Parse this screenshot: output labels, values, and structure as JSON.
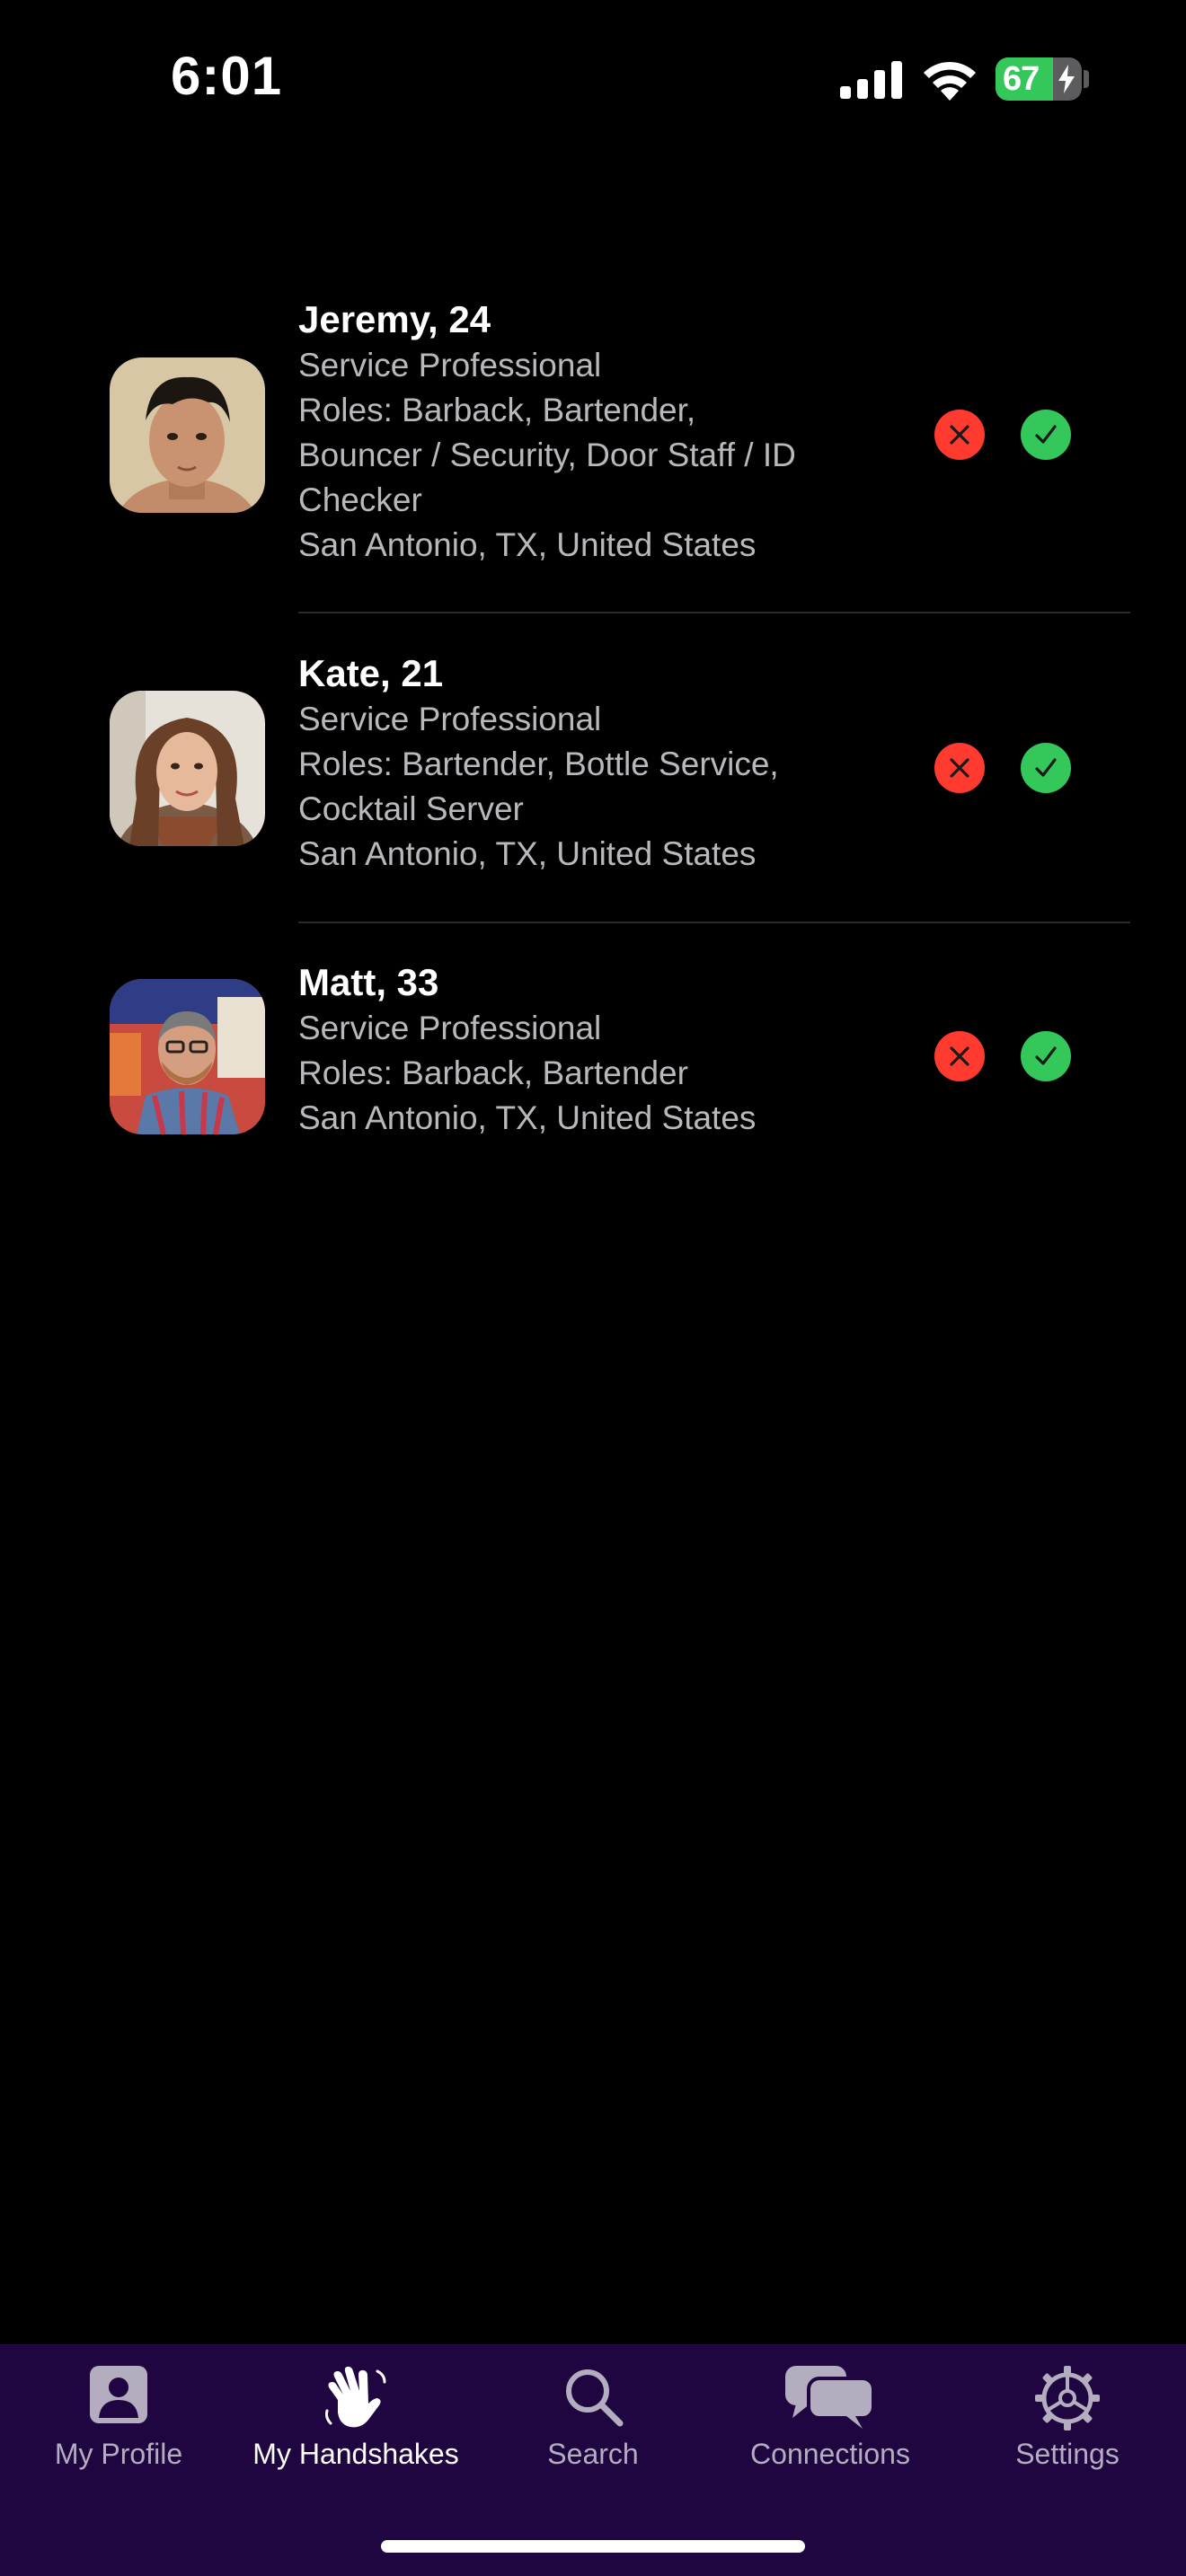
{
  "status_bar": {
    "time": "6:01",
    "battery_level": "67",
    "battery_fraction": 0.67,
    "battery_charging": true,
    "icons": [
      "signal-icon",
      "wifi-icon",
      "battery-icon",
      "bolt-icon"
    ]
  },
  "handshakes": [
    {
      "name": "Jeremy, 24",
      "type": "Service Professional",
      "roles_lines": [
        "Roles: Barback, Bartender,",
        "Bouncer / Security, Door Staff / ID",
        "Checker"
      ],
      "location": "San Antonio, TX, United States"
    },
    {
      "name": "Kate, 21",
      "type": "Service Professional",
      "roles_lines": [
        "Roles: Bartender, Bottle Service,",
        "Cocktail Server"
      ],
      "location": "San Antonio, TX, United States"
    },
    {
      "name": "Matt, 33",
      "type": "Service Professional",
      "roles_lines": [
        "Roles: Barback, Bartender"
      ],
      "location": "San Antonio, TX, United States"
    }
  ],
  "actions": {
    "reject_icon": "close-icon",
    "accept_icon": "checkmark-icon"
  },
  "tab_bar": {
    "tabs": [
      {
        "label": "My Profile",
        "icon": "person-icon",
        "active": false
      },
      {
        "label": "My Handshakes",
        "icon": "hand-wave-icon",
        "active": true
      },
      {
        "label": "Search",
        "icon": "search-icon",
        "active": false
      },
      {
        "label": "Connections",
        "icon": "chat-bubbles-icon",
        "active": false
      },
      {
        "label": "Settings",
        "icon": "gear-icon",
        "active": false
      }
    ]
  },
  "colors": {
    "background": "#000000",
    "tab_bar_bg": "#1f0640",
    "reject": "#ff3b30",
    "accept": "#34c759",
    "secondary_text": "#b9b9bd"
  }
}
